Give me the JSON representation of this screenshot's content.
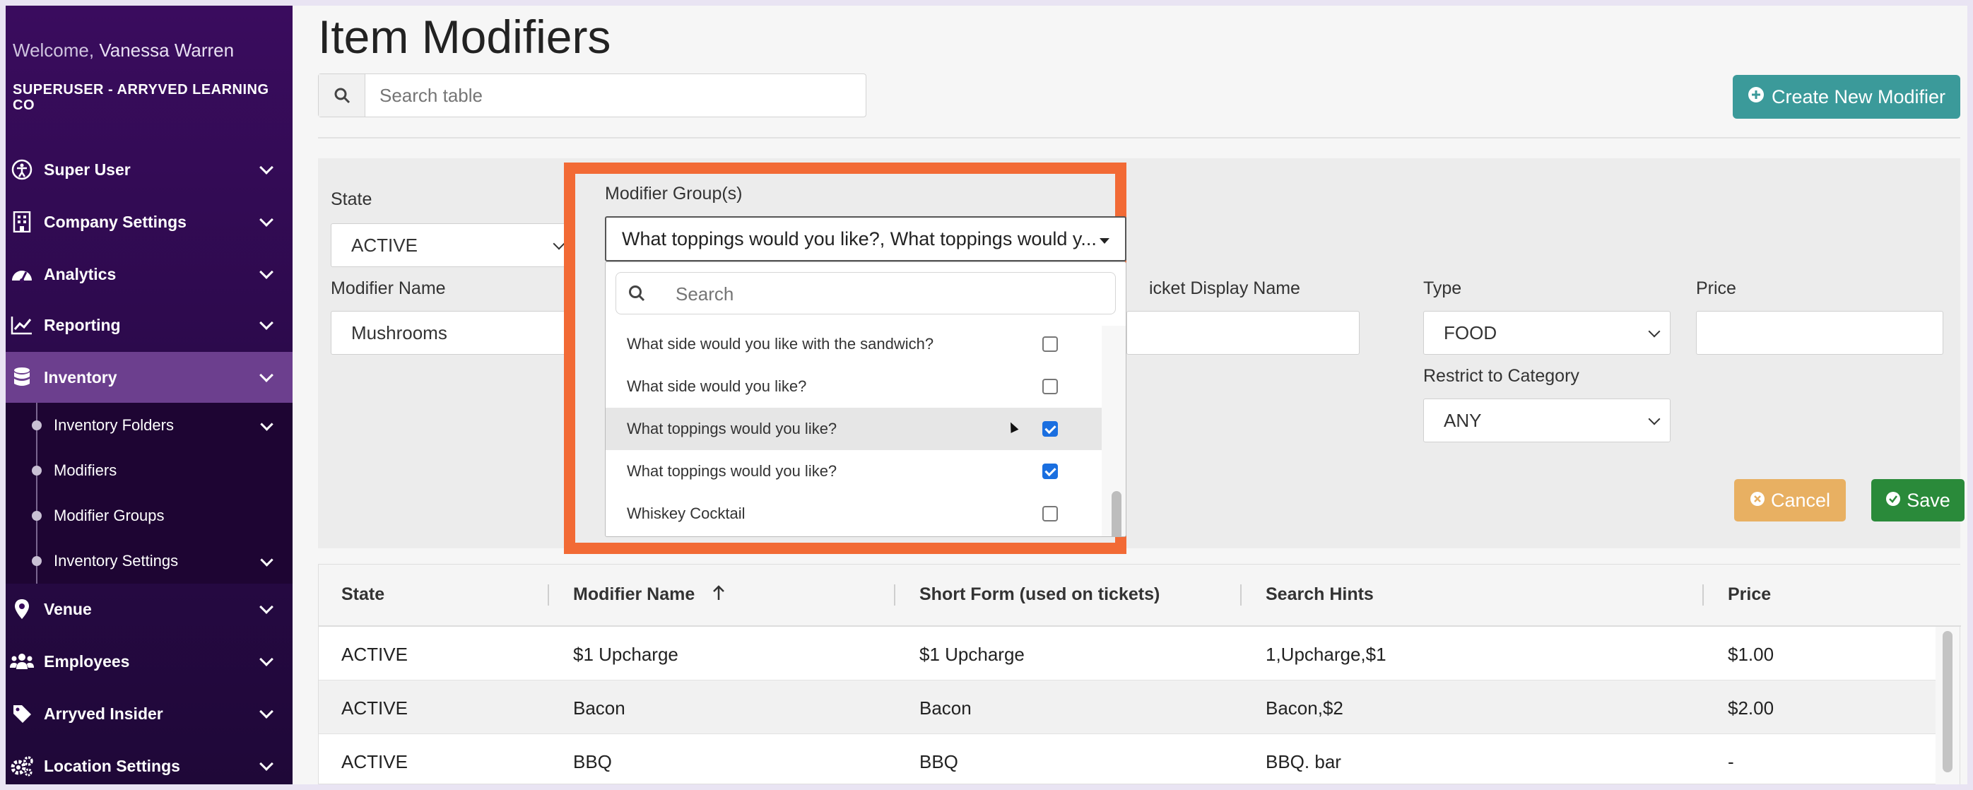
{
  "sidebar": {
    "welcome_prefix": "Welcome,",
    "user_name": "Vanessa Warren",
    "org": "SUPERUSER - ARRYVED LEARNING CO",
    "items": [
      {
        "label": "Super User",
        "icon": "accessibility-icon"
      },
      {
        "label": "Company Settings",
        "icon": "building-icon"
      },
      {
        "label": "Analytics",
        "icon": "gauge-icon"
      },
      {
        "label": "Reporting",
        "icon": "line-chart-icon"
      },
      {
        "label": "Inventory",
        "icon": "database-icon"
      },
      {
        "label": "Venue",
        "icon": "map-pin-icon"
      },
      {
        "label": "Employees",
        "icon": "users-icon"
      },
      {
        "label": "Arryved Insider",
        "icon": "tag-icon"
      },
      {
        "label": "Location Settings",
        "icon": "gears-icon"
      }
    ],
    "sub_items": [
      {
        "label": "Inventory Folders"
      },
      {
        "label": "Modifiers"
      },
      {
        "label": "Modifier Groups"
      },
      {
        "label": "Inventory Settings"
      }
    ]
  },
  "header": {
    "title": "Item Modifiers",
    "search_placeholder": "Search table",
    "create_button": "Create New Modifier"
  },
  "form": {
    "state_label": "State",
    "state_value": "ACTIVE",
    "modifier_name_label": "Modifier Name",
    "modifier_name_value": "Mushrooms",
    "modifier_groups_label": "Modifier Group(s)",
    "modifier_groups_value": "What toppings would you like?, What toppings would y...",
    "ticket_display_label": "icket Display Name",
    "type_label": "Type",
    "type_value": "FOOD",
    "price_label": "Price",
    "price_value": "",
    "restrict_label": "Restrict to Category",
    "restrict_value": "ANY",
    "cancel": "Cancel",
    "save": "Save"
  },
  "dropdown": {
    "search_placeholder": "Search",
    "options": [
      {
        "label": "What side would you like with the sandwich?",
        "checked": false
      },
      {
        "label": "What side would you like?",
        "checked": false
      },
      {
        "label": "What toppings would you like?",
        "checked": true
      },
      {
        "label": "What toppings would you like?",
        "checked": true
      },
      {
        "label": "Whiskey Cocktail",
        "checked": false
      }
    ]
  },
  "table": {
    "headers": [
      "State",
      "Modifier Name",
      "Short Form (used on tickets)",
      "Search Hints",
      "Price"
    ],
    "rows": [
      [
        "ACTIVE",
        "$1 Upcharge",
        "$1 Upcharge",
        "1,Upcharge,$1",
        "$1.00"
      ],
      [
        "ACTIVE",
        "Bacon",
        "Bacon",
        "Bacon,$2",
        "$2.00"
      ],
      [
        "ACTIVE",
        "BBQ",
        "BBQ",
        "BBQ. bar",
        "-"
      ]
    ]
  },
  "colors": {
    "sidebar": "#3a0c5e",
    "highlight": "#f26a35",
    "create_button": "#3b9a9a",
    "cancel_button": "#e8b062",
    "save_button": "#2a8a3a",
    "checkbox_checked": "#1a6fe0"
  }
}
